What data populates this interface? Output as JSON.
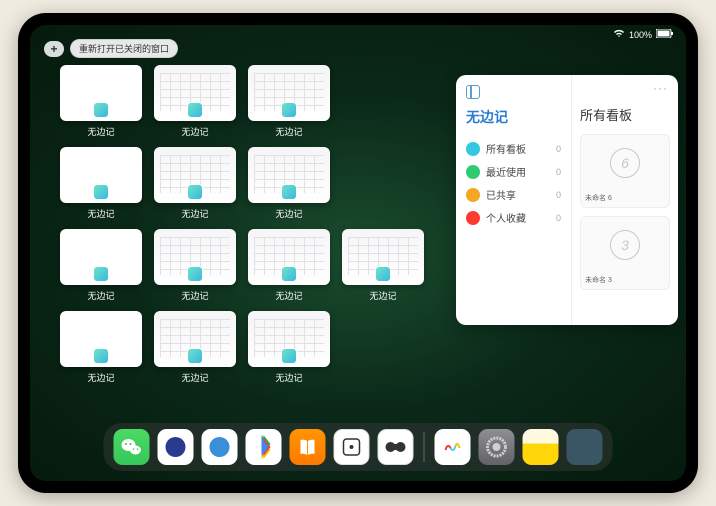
{
  "status": {
    "battery": "100%"
  },
  "top": {
    "add": "+",
    "reopen_label": "重新打开已关闭的窗口"
  },
  "app_name": "无边记",
  "grid_tiles": [
    {
      "style": "blank"
    },
    {
      "style": "calendar"
    },
    {
      "style": "calendar"
    },
    null,
    {
      "style": "blank"
    },
    {
      "style": "calendar"
    },
    {
      "style": "calendar"
    },
    null,
    {
      "style": "blank"
    },
    {
      "style": "calendar"
    },
    {
      "style": "calendar"
    },
    {
      "style": "calendar"
    },
    {
      "style": "blank"
    },
    {
      "style": "calendar"
    },
    {
      "style": "calendar"
    },
    null
  ],
  "panel": {
    "left_title": "无边记",
    "right_title": "所有看板",
    "items": [
      {
        "label": "所有看板",
        "count": "0",
        "color": "#34c7e0"
      },
      {
        "label": "最近使用",
        "count": "0",
        "color": "#2ecc71"
      },
      {
        "label": "已共享",
        "count": "0",
        "color": "#f5a623"
      },
      {
        "label": "个人收藏",
        "count": "0",
        "color": "#ff3b30"
      }
    ],
    "boards": [
      {
        "sketch": "6",
        "caption": "未命名 6",
        "sub": ""
      },
      {
        "sketch": "3",
        "caption": "未命名 3",
        "sub": ""
      }
    ],
    "ellipsis": "···"
  },
  "dock": {
    "apps": [
      {
        "id": "wechat",
        "name": "wechat-icon"
      },
      {
        "id": "quark1",
        "name": "quark-hd-icon"
      },
      {
        "id": "quark2",
        "name": "quark-icon"
      },
      {
        "id": "play",
        "name": "play-store-icon"
      },
      {
        "id": "books",
        "name": "books-icon"
      },
      {
        "id": "dice",
        "name": "dice-icon"
      },
      {
        "id": "game",
        "name": "game-icon"
      }
    ],
    "recent": [
      {
        "id": "freeform",
        "name": "freeform-icon"
      },
      {
        "id": "settings",
        "name": "settings-icon"
      },
      {
        "id": "notes",
        "name": "notes-icon"
      },
      {
        "id": "appgrid",
        "name": "app-library-icon"
      }
    ]
  }
}
